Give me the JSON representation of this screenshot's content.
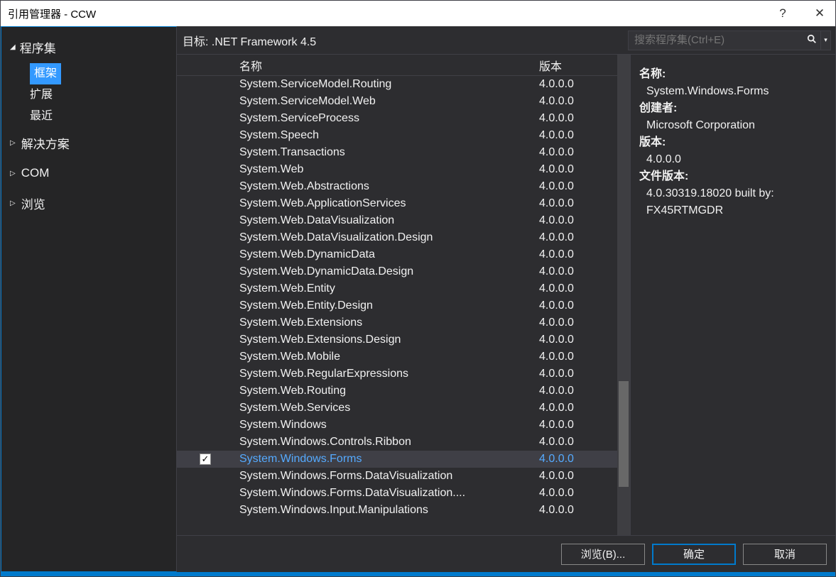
{
  "window": {
    "title": "引用管理器 - CCW"
  },
  "titlebar": {
    "help": "?",
    "close": "✕"
  },
  "sidebar": {
    "tab_label": "程序集",
    "sub": {
      "framework": "框架",
      "extensions": "扩展",
      "recent": "最近"
    },
    "groups": {
      "solution": "解决方案",
      "com": "COM",
      "browse": "浏览"
    }
  },
  "topbar": {
    "target_prefix": "目标: ",
    "target": ".NET Framework 4.5",
    "search_placeholder": "搜索程序集(Ctrl+E)"
  },
  "columns": {
    "name": "名称",
    "version": "版本"
  },
  "rows": [
    {
      "name": "System.ServiceModel.Routing",
      "version": "4.0.0.0",
      "checked": false
    },
    {
      "name": "System.ServiceModel.Web",
      "version": "4.0.0.0",
      "checked": false
    },
    {
      "name": "System.ServiceProcess",
      "version": "4.0.0.0",
      "checked": false
    },
    {
      "name": "System.Speech",
      "version": "4.0.0.0",
      "checked": false
    },
    {
      "name": "System.Transactions",
      "version": "4.0.0.0",
      "checked": false
    },
    {
      "name": "System.Web",
      "version": "4.0.0.0",
      "checked": false
    },
    {
      "name": "System.Web.Abstractions",
      "version": "4.0.0.0",
      "checked": false
    },
    {
      "name": "System.Web.ApplicationServices",
      "version": "4.0.0.0",
      "checked": false
    },
    {
      "name": "System.Web.DataVisualization",
      "version": "4.0.0.0",
      "checked": false
    },
    {
      "name": "System.Web.DataVisualization.Design",
      "version": "4.0.0.0",
      "checked": false
    },
    {
      "name": "System.Web.DynamicData",
      "version": "4.0.0.0",
      "checked": false
    },
    {
      "name": "System.Web.DynamicData.Design",
      "version": "4.0.0.0",
      "checked": false
    },
    {
      "name": "System.Web.Entity",
      "version": "4.0.0.0",
      "checked": false
    },
    {
      "name": "System.Web.Entity.Design",
      "version": "4.0.0.0",
      "checked": false
    },
    {
      "name": "System.Web.Extensions",
      "version": "4.0.0.0",
      "checked": false
    },
    {
      "name": "System.Web.Extensions.Design",
      "version": "4.0.0.0",
      "checked": false
    },
    {
      "name": "System.Web.Mobile",
      "version": "4.0.0.0",
      "checked": false
    },
    {
      "name": "System.Web.RegularExpressions",
      "version": "4.0.0.0",
      "checked": false
    },
    {
      "name": "System.Web.Routing",
      "version": "4.0.0.0",
      "checked": false
    },
    {
      "name": "System.Web.Services",
      "version": "4.0.0.0",
      "checked": false
    },
    {
      "name": "System.Windows",
      "version": "4.0.0.0",
      "checked": false
    },
    {
      "name": "System.Windows.Controls.Ribbon",
      "version": "4.0.0.0",
      "checked": false
    },
    {
      "name": "System.Windows.Forms",
      "version": "4.0.0.0",
      "checked": true,
      "selected": true
    },
    {
      "name": "System.Windows.Forms.DataVisualization",
      "version": "4.0.0.0",
      "checked": false
    },
    {
      "name": "System.Windows.Forms.DataVisualization....",
      "version": "4.0.0.0",
      "checked": false
    },
    {
      "name": "System.Windows.Input.Manipulations",
      "version": "4.0.0.0",
      "checked": false
    }
  ],
  "details": {
    "name_label": "名称:",
    "name_value": "System.Windows.Forms",
    "creator_label": "创建者:",
    "creator_value": "Microsoft Corporation",
    "version_label": "版本:",
    "version_value": "4.0.0.0",
    "filever_label": "文件版本:",
    "filever_value1": "4.0.30319.18020 built by:",
    "filever_value2": "FX45RTMGDR"
  },
  "footer": {
    "browse": "浏览(B)...",
    "ok": "确定",
    "cancel": "取消"
  }
}
